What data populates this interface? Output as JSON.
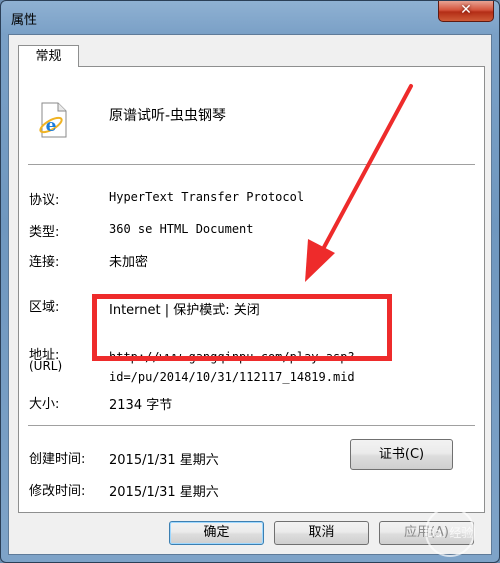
{
  "window": {
    "title": "属性",
    "close_glyph": "✕"
  },
  "tabs": [
    {
      "label": "常规",
      "selected": true
    }
  ],
  "file": {
    "name": "原谱试听-虫虫钢琴",
    "icon": "internet-explorer-shortcut-icon"
  },
  "properties": {
    "protocol": {
      "label": "协议:",
      "value": "HyperText Transfer Protocol"
    },
    "type": {
      "label": "类型:",
      "value": "360 se HTML Document"
    },
    "connection": {
      "label": "连接:",
      "value": "未加密"
    },
    "zone": {
      "label": "区域:",
      "value": "Internet | 保护模式: 关闭"
    },
    "address": {
      "label": "地址:",
      "label_sub": "(URL)",
      "value_line1": "http://www.gangqinpu.com/play.asp?",
      "value_line2": "id=/pu/2014/10/31/112117_14819.mid"
    },
    "size": {
      "label": "大小:",
      "value": "2134 字节"
    },
    "created": {
      "label": "创建时间:",
      "value": "2015/1/31 星期六"
    },
    "modified": {
      "label": "修改时间:",
      "value": "2015/1/31 星期六"
    }
  },
  "buttons": {
    "certificate": "证书(C)",
    "ok": "确定",
    "cancel": "取消",
    "apply": "应用(A)"
  },
  "annotation": {
    "highlight_color": "#ee2b2b",
    "arrow_color": "#ee2b2b"
  },
  "watermark": {
    "text": "Bai 经验"
  }
}
